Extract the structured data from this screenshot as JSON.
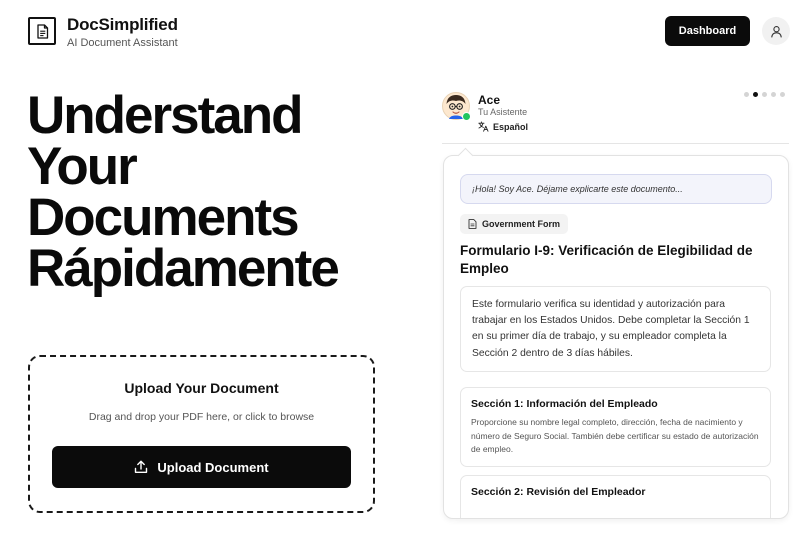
{
  "header": {
    "brand_name": "DocSimplified",
    "brand_tagline": "AI Document Assistant",
    "logo_icon": "document-icon",
    "dashboard_label": "Dashboard",
    "user_icon": "user-icon"
  },
  "hero": {
    "lines": [
      "Understand",
      "Your",
      "Documents",
      "Rápidamente"
    ]
  },
  "upload": {
    "title": "Upload Your Document",
    "subtitle": "Drag and drop your PDF here, or click to browse",
    "button_label": "Upload Document",
    "button_icon": "upload-icon"
  },
  "assistant": {
    "name": "Ace",
    "role": "Tu Asistente",
    "language": "Español",
    "language_icon": "translate-icon",
    "status_color": "#22c55e",
    "slides": {
      "count": 5,
      "active_index": 1
    }
  },
  "card": {
    "greeting": "¡Hola! Soy Ace. Déjame explicarte este documento...",
    "tag_label": "Government Form",
    "tag_icon": "document-icon",
    "form_title": "Formulario I-9: Verificación de Elegibilidad de Empleo",
    "summary": "Este formulario verifica su identidad y autorización para trabajar en los Estados Unidos. Debe completar la Sección 1 en su primer día de trabajo, y su empleador completa la Sección 2 dentro de 3 días hábiles.",
    "sections": [
      {
        "title": "Sección 1: Información del Empleado",
        "body": "Proporcione su nombre legal completo, dirección, fecha de nacimiento y número de Seguro Social. También debe certificar su estado de autorización de empleo."
      },
      {
        "title": "Sección 2: Revisión del Empleador",
        "body": ""
      }
    ]
  }
}
